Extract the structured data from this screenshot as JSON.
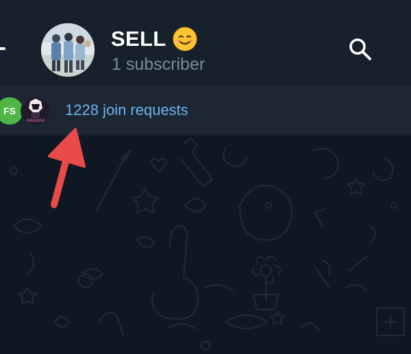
{
  "channel": {
    "title": "SELL",
    "title_emoji": "smiling-face-emoji",
    "subtitle": "1 subscriber"
  },
  "requests": {
    "avatar_initials": "FS",
    "avatar_badge_text": "MADARA",
    "label": "1228 join requests"
  },
  "icons": {
    "back": "back-arrow-icon",
    "search": "search-icon",
    "annotation": "red-arrow-annotation"
  },
  "colors": {
    "header_bg": "#17212b",
    "requests_bg": "#1c2733",
    "chat_bg": "#0f1722",
    "link_blue": "#6cb4ef",
    "subtitle_gray": "#7c8a99",
    "avatar_green": "#4fb544",
    "annotation_red": "#e94b4b"
  }
}
